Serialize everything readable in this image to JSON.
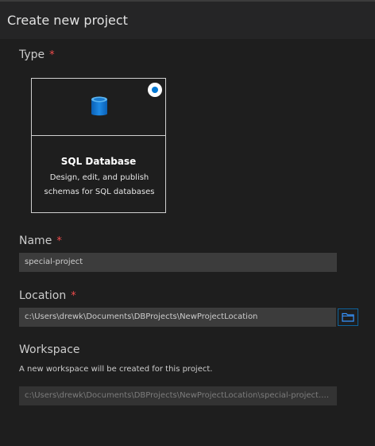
{
  "header": {
    "title": "Create new project"
  },
  "type_section": {
    "label": "Type",
    "required_mark": "*"
  },
  "project_type": {
    "title": "SQL Database",
    "description": "Design, edit, and publish schemas for SQL databases",
    "icon": "database-icon",
    "selected": true
  },
  "name_section": {
    "label": "Name",
    "required_mark": "*",
    "value": "special-project"
  },
  "location_section": {
    "label": "Location",
    "required_mark": "*",
    "value": "c:\\Users\\drewk\\Documents\\DBProjects\\NewProjectLocation",
    "browse_icon": "folder-icon"
  },
  "workspace_section": {
    "label": "Workspace",
    "note": "A new workspace will be created for this project.",
    "value": "c:\\Users\\drewk\\Documents\\DBProjects\\NewProjectLocation\\special-project.co..."
  },
  "colors": {
    "background": "#1e1e1e",
    "header": "#252526",
    "input": "#3c3c3c",
    "required": "#f14c4c",
    "accent": "#0078d4"
  }
}
